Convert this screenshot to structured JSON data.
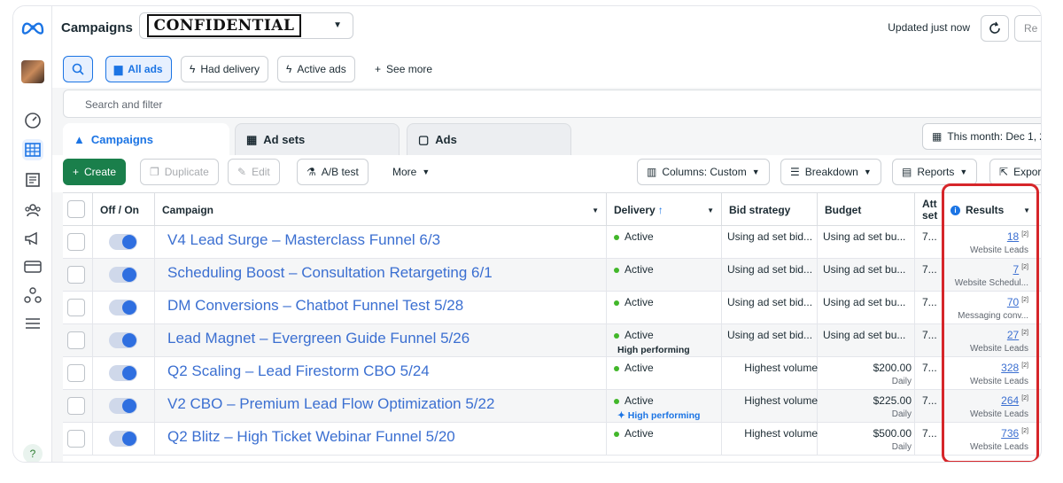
{
  "header": {
    "title": "Campaigns",
    "account_stamp": "CONFIDENTIAL",
    "updated_text": "Updated just now",
    "review_label": "Re"
  },
  "filters": {
    "all_ads": "All ads",
    "had_delivery": "Had delivery",
    "active_ads": "Active ads",
    "see_more": "See more"
  },
  "search": {
    "placeholder": "Search and filter"
  },
  "tabs": {
    "campaigns": "Campaigns",
    "ad_sets": "Ad sets",
    "ads": "Ads"
  },
  "date_range": "This month: Dec 1, 2",
  "toolbar": {
    "create": "Create",
    "duplicate": "Duplicate",
    "edit": "Edit",
    "ab_test": "A/B test",
    "more": "More",
    "columns": "Columns: Custom",
    "breakdown": "Breakdown",
    "reports": "Reports",
    "export": "Expor"
  },
  "columns": {
    "offon": "Off / On",
    "campaign": "Campaign",
    "delivery": "Delivery",
    "bid_strategy": "Bid strategy",
    "budget": "Budget",
    "attribution": "Att set",
    "results": "Results"
  },
  "rows": [
    {
      "name": "V4 Lead Surge – Masterclass Funnel 6/3",
      "delivery": "Active",
      "badge": "",
      "bid": "Using ad set bid...",
      "budget": "Using ad set bu...",
      "budget_sub": "",
      "attr": "7...",
      "result": "18",
      "result_label": "Website Leads"
    },
    {
      "name": "Scheduling Boost – Consultation Retargeting 6/1",
      "delivery": "Active",
      "badge": "",
      "bid": "Using ad set bid...",
      "budget": "Using ad set bu...",
      "budget_sub": "",
      "attr": "7...",
      "result": "7",
      "result_label": "Website Schedul..."
    },
    {
      "name": "DM Conversions – Chatbot Funnel Test 5/28",
      "delivery": "Active",
      "badge": "",
      "bid": "Using ad set bid...",
      "budget": "Using ad set bu...",
      "budget_sub": "",
      "attr": "7...",
      "result": "70",
      "result_label": "Messaging conv..."
    },
    {
      "name": "Lead Magnet – Evergreen Guide Funnel 5/26",
      "delivery": "Active",
      "badge": "High performing",
      "bid": "Using ad set bid...",
      "budget": "Using ad set bu...",
      "budget_sub": "",
      "attr": "7...",
      "result": "27",
      "result_label": "Website Leads"
    },
    {
      "name": "Q2 Scaling – Lead Firestorm CBO 5/24",
      "delivery": "Active",
      "badge": "",
      "bid": "Highest volume",
      "budget": "$200.00",
      "budget_sub": "Daily",
      "attr": "7...",
      "result": "328",
      "result_label": "Website Leads"
    },
    {
      "name": "V2 CBO – Premium Lead Flow Optimization 5/22",
      "delivery": "Active",
      "badge": "High performing",
      "bid": "Highest volume",
      "budget": "$225.00",
      "budget_sub": "Daily",
      "attr": "7...",
      "result": "264",
      "result_label": "Website Leads"
    },
    {
      "name": "Q2 Blitz – High Ticket Webinar Funnel 5/20",
      "delivery": "Active",
      "badge": "",
      "bid": "Highest volume",
      "budget": "$500.00",
      "budget_sub": "Daily",
      "attr": "7...",
      "result": "736",
      "result_label": "Website Leads"
    }
  ],
  "result_sup": "[2]"
}
